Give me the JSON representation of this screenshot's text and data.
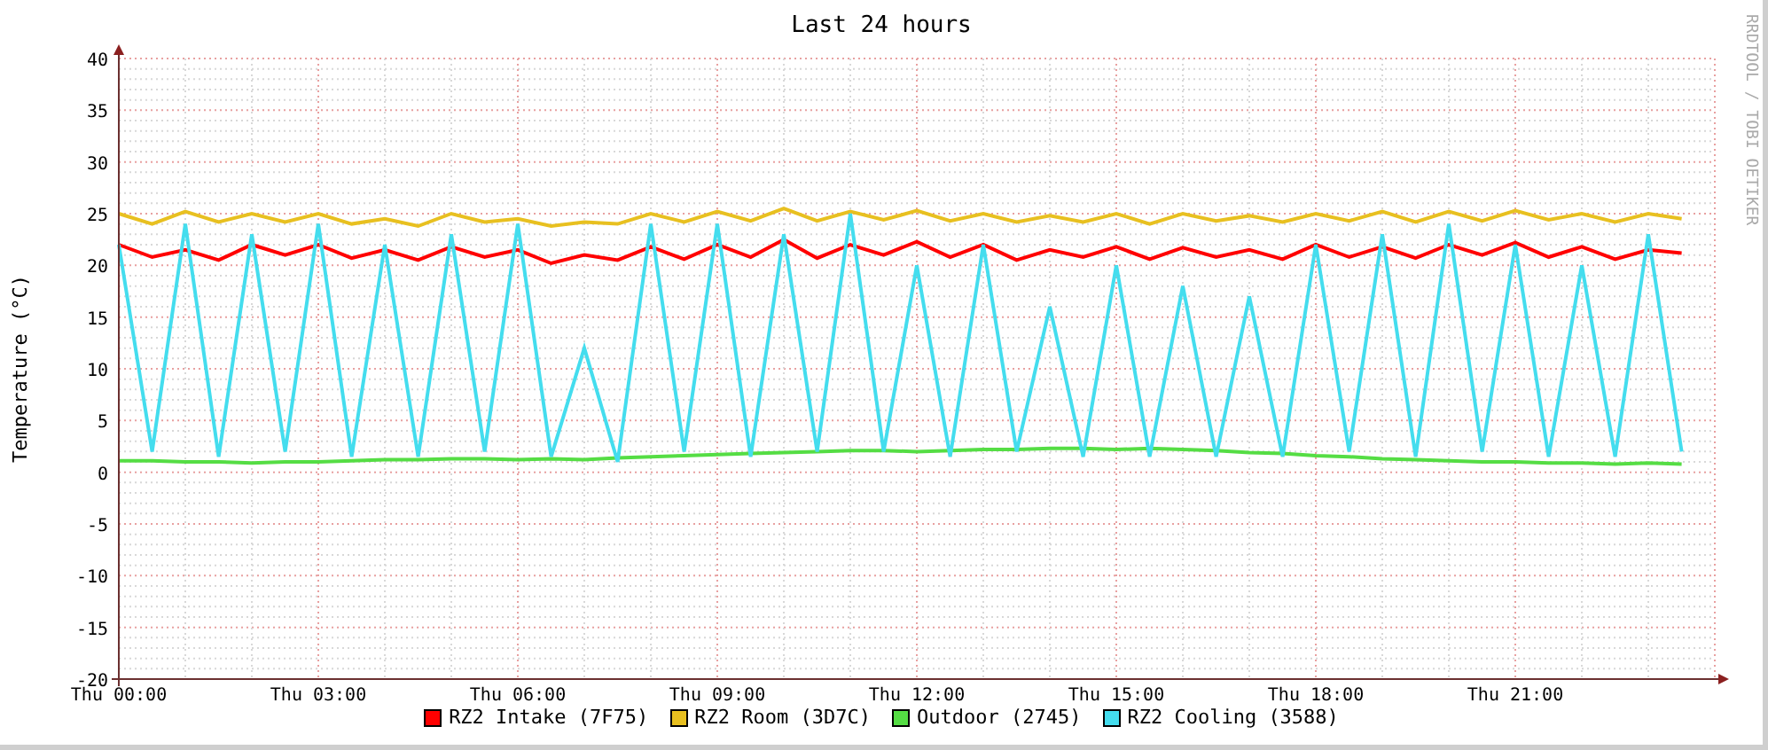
{
  "chart_data": {
    "type": "line",
    "title": "Last 24 hours",
    "ylabel": "Temperature (°C)",
    "grid": true,
    "ylim": [
      -20,
      40
    ],
    "categories": [
      "Thu 00:00",
      null,
      null,
      null,
      null,
      null,
      "Thu 03:00",
      null,
      null,
      null,
      null,
      null,
      "Thu 06:00",
      null,
      null,
      null,
      null,
      null,
      "Thu 09:00",
      null,
      null,
      null,
      null,
      null,
      "Thu 12:00",
      null,
      null,
      null,
      null,
      null,
      "Thu 15:00",
      null,
      null,
      null,
      null,
      null,
      "Thu 18:00",
      null,
      null,
      null,
      null,
      null,
      "Thu 21:00",
      null,
      null,
      null,
      null,
      null
    ],
    "yticks": [
      -20,
      -15,
      -10,
      -5,
      0,
      5,
      10,
      15,
      20,
      25,
      30,
      35,
      40
    ],
    "series": [
      {
        "name": "RZ2 Intake (7F75)",
        "color": "#ff0000",
        "values": [
          22,
          20.8,
          21.5,
          20.5,
          22,
          21,
          22,
          20.7,
          21.5,
          20.5,
          21.8,
          20.8,
          21.5,
          20.2,
          21,
          20.5,
          21.8,
          20.6,
          22,
          20.8,
          22.5,
          20.7,
          22,
          21,
          22.3,
          20.8,
          22,
          20.5,
          21.5,
          20.8,
          21.8,
          20.6,
          21.7,
          20.8,
          21.5,
          20.6,
          22,
          20.8,
          21.8,
          20.7,
          22,
          21,
          22.2,
          20.8,
          21.8,
          20.6,
          21.5,
          21.2
        ]
      },
      {
        "name": "RZ2 Room (3D7C)",
        "color": "#e8c020",
        "values": [
          25,
          24,
          25.2,
          24.2,
          25,
          24.2,
          25,
          24,
          24.5,
          23.8,
          25,
          24.2,
          24.5,
          23.8,
          24.2,
          24,
          25,
          24.2,
          25.2,
          24.3,
          25.5,
          24.3,
          25.2,
          24.4,
          25.3,
          24.3,
          25,
          24.2,
          24.8,
          24.2,
          25,
          24,
          25,
          24.3,
          24.8,
          24.2,
          25,
          24.3,
          25.2,
          24.2,
          25.2,
          24.3,
          25.3,
          24.4,
          25,
          24.2,
          25,
          24.5
        ]
      },
      {
        "name": "Outdoor (2745)",
        "color": "#55dd44",
        "values": [
          1.1,
          1.1,
          1,
          1,
          0.9,
          1,
          1,
          1.1,
          1.2,
          1.2,
          1.3,
          1.3,
          1.2,
          1.3,
          1.2,
          1.4,
          1.5,
          1.6,
          1.7,
          1.8,
          1.9,
          2,
          2.1,
          2.1,
          2,
          2.1,
          2.2,
          2.2,
          2.3,
          2.3,
          2.2,
          2.3,
          2.2,
          2.1,
          1.9,
          1.8,
          1.6,
          1.5,
          1.3,
          1.2,
          1.1,
          1,
          1,
          0.9,
          0.9,
          0.8,
          0.9,
          0.8
        ]
      },
      {
        "name": "RZ2 Cooling (3588)",
        "color": "#44ddee",
        "values": [
          22,
          2,
          24,
          1.5,
          23,
          2,
          24,
          1.5,
          22,
          1.5,
          23,
          2,
          24,
          1.5,
          12,
          1,
          24,
          2,
          24,
          1.5,
          23,
          2,
          25,
          2,
          20,
          1.5,
          22,
          2,
          16,
          1.5,
          20,
          1.5,
          18,
          1.5,
          17,
          1.5,
          22,
          2,
          23,
          1.5,
          24,
          2,
          22,
          1.5,
          20,
          1.5,
          23,
          2
        ]
      }
    ]
  },
  "credit": "RRDTOOL / TOBI OETIKER"
}
